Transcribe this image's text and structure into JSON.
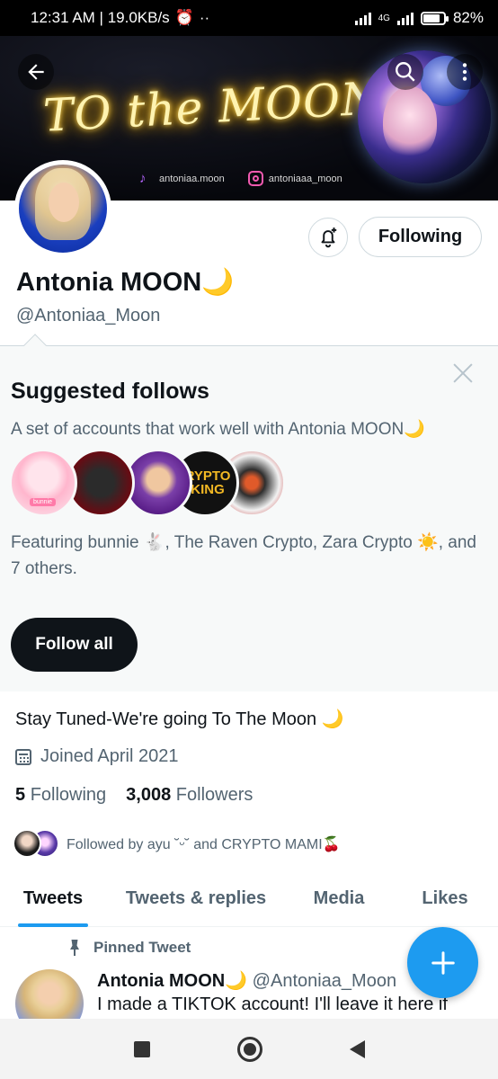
{
  "status_bar": {
    "time_speed": "12:31 AM | 19.0KB/s",
    "network": "4G",
    "battery": "82%",
    "battery_level": 0.82
  },
  "banner": {
    "title": "TO the MOON",
    "tiktok_handle": "antoniaa.moon",
    "instagram_handle": "antoniaaa_moon"
  },
  "profile": {
    "display_name": "Antonia MOON🌙",
    "handle": "@Antoniaa_Moon",
    "following_button": "Following"
  },
  "suggested": {
    "title": "Suggested follows",
    "subtitle": "A set of accounts that work well with Antonia MOON🌙",
    "avatar1_label": "bunnie",
    "avatar4_label": "RYPTO KING",
    "featuring": "Featuring bunnie 🐇, The Raven Crypto, Zara Crypto ☀️, and 7 others.",
    "follow_all": "Follow all"
  },
  "bio": {
    "text": "Stay Tuned-We're going To The Moon 🌙",
    "joined": "Joined April 2021",
    "following_count": "5",
    "following_label": "Following",
    "followers_count": "3,008",
    "followers_label": "Followers",
    "followed_by": "Followed by ayu ˘ᵕ˘ and CRYPTO MAMI🍒"
  },
  "tabs": [
    {
      "label": "Tweets"
    },
    {
      "label": "Tweets & replies"
    },
    {
      "label": "Media"
    },
    {
      "label": "Likes"
    }
  ],
  "pinned_tweet": {
    "pinned_label": "Pinned Tweet",
    "name": "Antonia MOON🌙",
    "handle": "@Antoniaa_Moon",
    "text": "I made a TIKTOK account! I'll leave it here if"
  },
  "colors": {
    "accent": "#1d9bf0",
    "text_primary": "#0f1419",
    "text_secondary": "#536471"
  }
}
